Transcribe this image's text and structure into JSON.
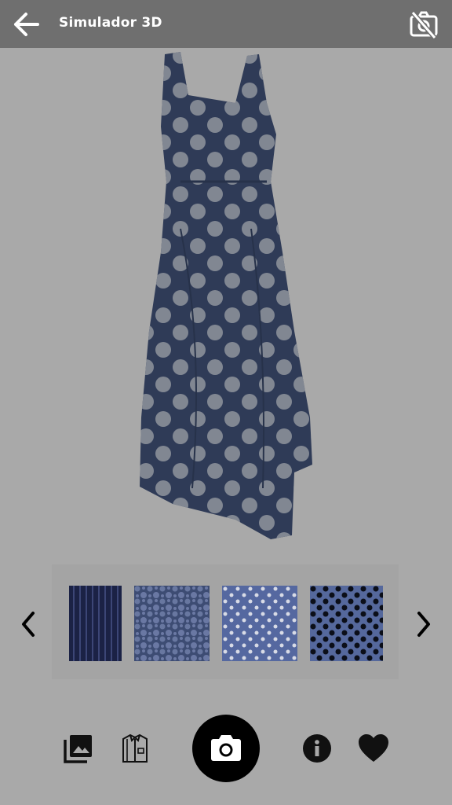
{
  "app": {
    "title": "Simulador 3D"
  },
  "icons": {
    "back": "arrow-left-icon",
    "camera_off": "camera-off-icon",
    "prev": "chevron-left-icon",
    "next": "chevron-right-icon",
    "gallery": "photo-library-icon",
    "garment": "shirt-icon",
    "camera": "camera-icon",
    "info": "info-icon",
    "favorite": "heart-icon"
  },
  "fabrics": [
    {
      "pattern": "pinstripe-navy"
    },
    {
      "pattern": "pebble-blue"
    },
    {
      "pattern": "small-dots-blue"
    },
    {
      "pattern": "black-dots-blue"
    }
  ],
  "colors": {
    "topbar": "#6f6f6f",
    "background": "#a9a9a9",
    "dress": "#2f3b57",
    "dots": "#8a8f99"
  }
}
